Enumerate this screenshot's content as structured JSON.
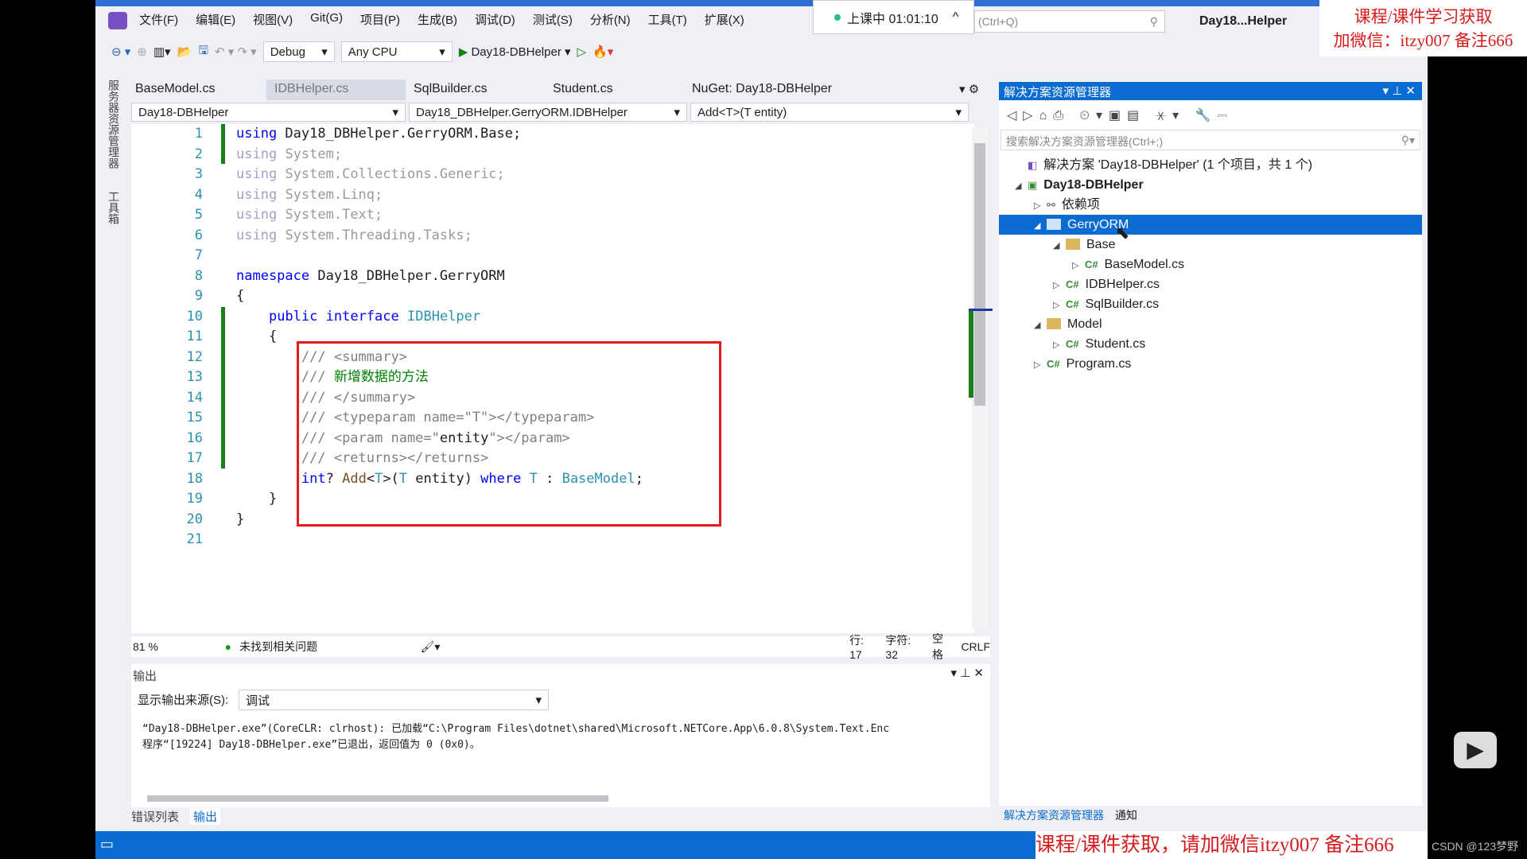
{
  "menu": [
    "文件(F)",
    "编辑(E)",
    "视图(V)",
    "Git(G)",
    "项目(P)",
    "生成(B)",
    "调试(D)",
    "测试(S)",
    "分析(N)",
    "工具(T)",
    "扩展(X)"
  ],
  "timer": "上课中 01:01:10",
  "search_placeholder": "(Ctrl+Q)",
  "window_title": "Day18...Helper",
  "toolbar": {
    "config": "Debug",
    "platform": "Any CPU",
    "start": "Day18-DBHelper"
  },
  "side_tabs": [
    "服务器资源管理器",
    "工具箱"
  ],
  "tabs": [
    "BaseModel.cs",
    "IDBHelper.cs",
    "SqlBuilder.cs",
    "Student.cs",
    "NuGet: Day18-DBHelper"
  ],
  "active_tab": "IDBHelper.cs",
  "nav": {
    "project": "Day18-DBHelper",
    "type": "Day18_DBHelper.GerryORM.IDBHelper",
    "member": "Add<T>(T entity)"
  },
  "code": [
    {
      "n": "1",
      "html": "<span class='kw'>using</span> Day18_DBHelper.GerryORM.Base;"
    },
    {
      "n": "2",
      "html": "<span class='dim'>using</span> <span class='gr'>System;</span>"
    },
    {
      "n": "3",
      "html": "<span class='dim'>using</span> <span class='gr'>System.Collections.Generic;</span>"
    },
    {
      "n": "4",
      "html": "<span class='dim'>using</span> <span class='gr'>System.Linq;</span>"
    },
    {
      "n": "5",
      "html": "<span class='dim'>using</span> <span class='gr'>System.Text;</span>"
    },
    {
      "n": "6",
      "html": "<span class='dim'>using</span> <span class='gr'>System.Threading.Tasks;</span>"
    },
    {
      "n": "7",
      "html": ""
    },
    {
      "n": "8",
      "html": "<span class='kw'>namespace</span> Day18_DBHelper.GerryORM"
    },
    {
      "n": "9",
      "html": "{"
    },
    {
      "n": "10",
      "html": "    <span class='kw'>public</span> <span class='kw'>interface</span> <span class='ty'>IDBHelper</span>"
    },
    {
      "n": "11",
      "html": "    {"
    },
    {
      "n": "12",
      "html": "        <span class='cm'>/// &lt;summary&gt;</span>"
    },
    {
      "n": "13",
      "html": "        <span class='cm'>///</span> <span class='zh'>新增数据的方法</span>"
    },
    {
      "n": "14",
      "html": "        <span class='cm'>/// &lt;/summary&gt;</span>"
    },
    {
      "n": "15",
      "html": "        <span class='cm'>/// &lt;typeparam name=\"T\"&gt;&lt;/typeparam&gt;</span>"
    },
    {
      "n": "16",
      "html": "        <span class='cm'>/// &lt;param name=\"</span>entity<span class='cm'>\"&gt;&lt;/param&gt;</span>"
    },
    {
      "n": "17",
      "html": "        <span class='cm'>/// &lt;returns&gt;&lt;/returns&gt;</span>"
    },
    {
      "n": "18",
      "html": "        <span class='kw'>int</span>? <span style='color:#74531f'>Add</span>&lt;<span class='ty'>T</span>&gt;(<span class='ty'>T</span> entity) <span class='kw'>where</span> <span class='ty'>T</span> : <span class='ty'>BaseModel</span>;"
    },
    {
      "n": "19",
      "html": "    }"
    },
    {
      "n": "20",
      "html": "}"
    },
    {
      "n": "21",
      "html": ""
    }
  ],
  "editor_status": {
    "zoom": "81 %",
    "issues": "未找到相关问题",
    "line": "行: 17",
    "char": "字符: 32",
    "spaces": "空格",
    "eol": "CRLF"
  },
  "output": {
    "title": "输出",
    "source_label": "显示输出来源(S):",
    "source": "调试",
    "lines": [
      "“Day18-DBHelper.exe”(CoreCLR: clrhost): 已加载“C:\\Program Files\\dotnet\\shared\\Microsoft.NETCore.App\\6.0.8\\System.Text.Enc",
      "程序“[19224] Day18-DBHelper.exe”已退出，返回值为 0 (0x0)。"
    ]
  },
  "bottom_tabs": [
    "错误列表",
    "输出"
  ],
  "solution_explorer": {
    "title": "解决方案资源管理器",
    "search_placeholder": "搜索解决方案资源管理器(Ctrl+;)",
    "items": [
      {
        "label": "解决方案 'Day18-DBHelper' (1 个项目，共 1 个)",
        "depth": 0,
        "icon": "solution",
        "arrow": ""
      },
      {
        "label": "Day18-DBHelper",
        "depth": 0,
        "icon": "csproj",
        "arrow": "expanded",
        "bold": true
      },
      {
        "label": "依赖项",
        "depth": 1,
        "icon": "dependencies",
        "arrow": "collapsed"
      },
      {
        "label": "GerryORM",
        "depth": 1,
        "icon": "folder",
        "arrow": "expanded",
        "selected": true
      },
      {
        "label": "Base",
        "depth": 2,
        "icon": "folder",
        "arrow": "expanded"
      },
      {
        "label": "BaseModel.cs",
        "depth": 3,
        "icon": "csharp",
        "arrow": "collapsed"
      },
      {
        "label": "IDBHelper.cs",
        "depth": 2,
        "icon": "csharp",
        "arrow": "collapsed"
      },
      {
        "label": "SqlBuilder.cs",
        "depth": 2,
        "icon": "csharp",
        "arrow": "collapsed"
      },
      {
        "label": "Model",
        "depth": 1,
        "icon": "folder",
        "arrow": "expanded"
      },
      {
        "label": "Student.cs",
        "depth": 2,
        "icon": "csharp",
        "arrow": "collapsed"
      },
      {
        "label": "Program.cs",
        "depth": 1,
        "icon": "csharp",
        "arrow": "collapsed"
      }
    ],
    "bottom_tabs": [
      "解决方案资源管理器",
      "通知"
    ]
  },
  "watermark_top": [
    "课程/课件学习获取",
    "加微信：itzy007 备注66б"
  ],
  "watermark_bottom": "课程/课件获取，请加微信itzy007 备注666",
  "credit": "CSDN @123梦野",
  "colors": {
    "accent": "#0a6bd0",
    "highlight": "#e21b1b"
  }
}
